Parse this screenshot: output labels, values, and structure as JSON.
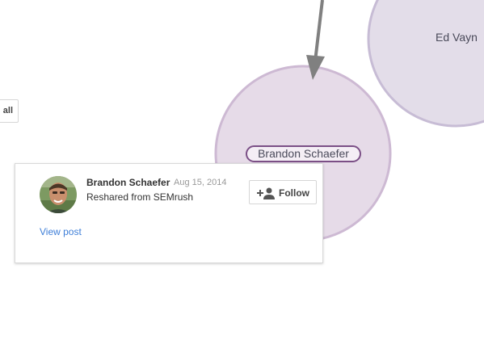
{
  "graph": {
    "view_all_label": "all",
    "nodes": [
      {
        "name": "Ed Vayn"
      },
      {
        "name": "Brandon Schaefer"
      }
    ]
  },
  "card": {
    "name": "Brandon Schaefer",
    "date": "Aug 15, 2014",
    "description": "Reshared from SEMrush",
    "follow_label": "Follow",
    "view_post_label": "View post"
  },
  "colors": {
    "node_fill": "#e6dbe8",
    "node_stroke": "#cdb9d3",
    "ed_node_fill": "#e3dde9",
    "ed_node_stroke": "#c7bcd5",
    "arrow": "#808080",
    "highlight_border": "#7b4f86",
    "link": "#3d7ed8"
  }
}
